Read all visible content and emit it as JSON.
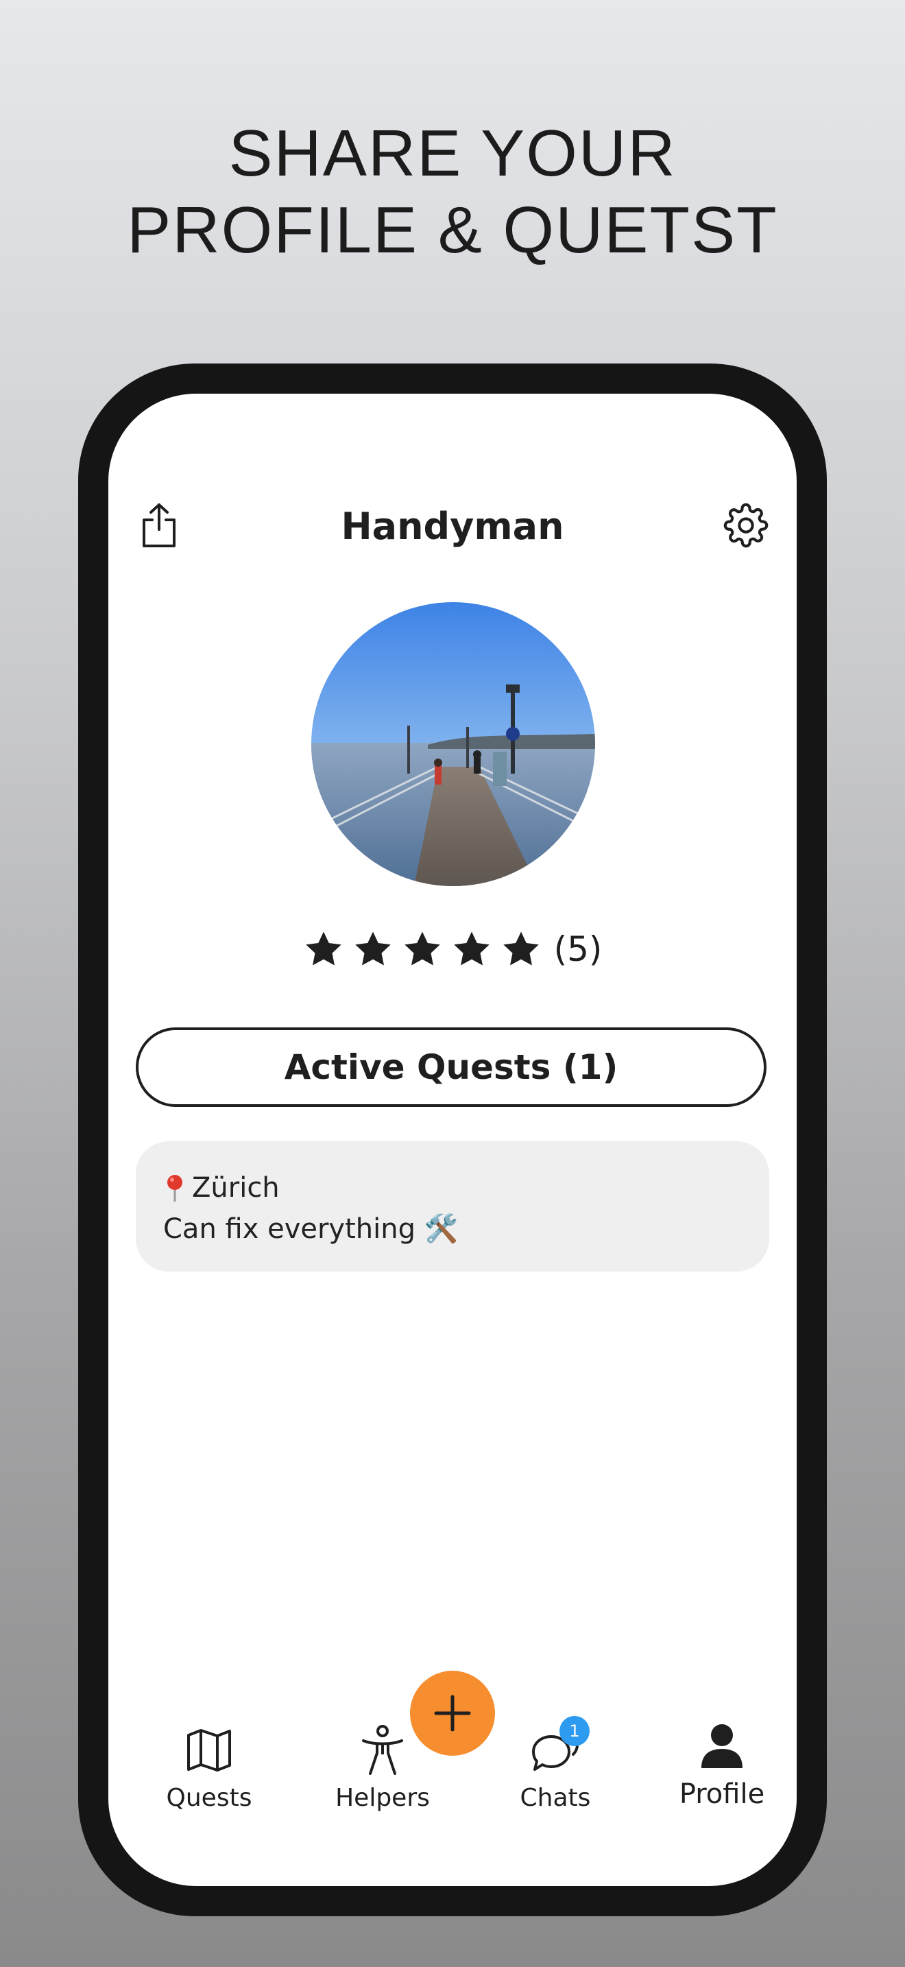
{
  "headline": {
    "line1": "SHARE YOUR",
    "line2": "PROFILE & QUETST"
  },
  "header": {
    "title": "Handyman",
    "share_icon": "share-icon",
    "settings_icon": "gear-icon"
  },
  "profile": {
    "avatar_alt": "profile-photo",
    "rating_stars": 5,
    "rating_count": "(5)"
  },
  "active_quests_button": "Active Quests (1)",
  "bio": {
    "location_icon": "pin-icon",
    "location": "Zürich",
    "description": "Can fix everything 🛠️"
  },
  "tab_bar": {
    "items": [
      {
        "label": "Quests",
        "icon": "map-icon"
      },
      {
        "label": "Helpers",
        "icon": "accessibility-icon"
      },
      {
        "label": "Chats",
        "icon": "chat-bubbles-icon",
        "badge": "1"
      },
      {
        "label": "Profile",
        "icon": "person-icon"
      }
    ],
    "fab_icon": "plus-icon"
  },
  "colors": {
    "accent_fab": "#f68d2e",
    "badge": "#2d9cf0",
    "text": "#1f1f1f",
    "card_bg": "#efefef"
  }
}
